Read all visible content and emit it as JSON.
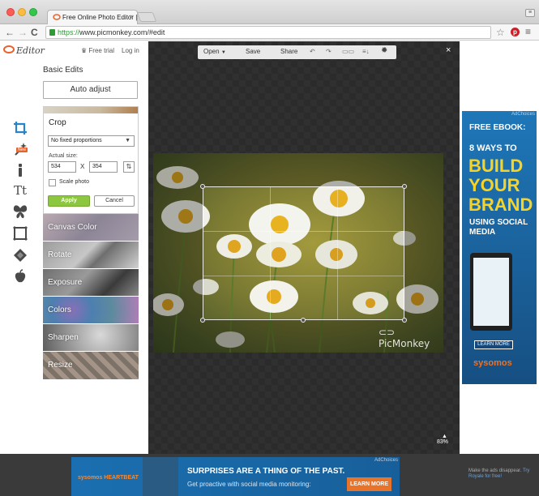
{
  "browser": {
    "tab_title": "Free Online Photo Editor |",
    "tab_close": "×",
    "url_scheme": "https://",
    "url_rest": "www.picmonkey.com/#edit",
    "back": "←",
    "forward": "→",
    "reload": "C",
    "star": "☆",
    "pinterest": "p",
    "menu": "≡"
  },
  "header": {
    "logo": "Editor",
    "free_trial": "Free trial",
    "login": "Log in"
  },
  "basic_edits": {
    "title": "Basic Edits",
    "auto_adjust": "Auto adjust"
  },
  "crop": {
    "title": "Crop",
    "proportions": "No fixed proportions",
    "actual_size_label": "Actual size:",
    "width": "534",
    "x_sep": "X",
    "height": "354",
    "scale_label": "Scale photo",
    "apply": "Apply",
    "cancel": "Cancel"
  },
  "edit_list": [
    "Canvas Color",
    "Rotate",
    "Exposure",
    "Colors",
    "Sharpen",
    "Resize"
  ],
  "tools": {
    "new_badge": "New",
    "text_tool": "Tt"
  },
  "editor_toolbar": {
    "open": "Open",
    "save": "Save",
    "share": "Share",
    "close": "×",
    "zoom": "83%"
  },
  "photo": {
    "watermark": "PicMonkey"
  },
  "right_ad": {
    "adchoices": "AdChoices",
    "line1": "FREE EBOOK:",
    "line2": "8 WAYS TO",
    "line3": "BUILD YOUR BRAND",
    "line4": "USING SOCIAL MEDIA",
    "learn_more": "LEARN MORE",
    "brand": "sysomos"
  },
  "bottom_ad": {
    "adchoices": "AdChoices",
    "brand": "sysomos HEARTBEAT",
    "headline": "SURPRISES ARE A THING OF THE PAST.",
    "subline": "Get proactive with social media monitoring:",
    "learn_more": "LEARN MORE"
  },
  "ads_note": {
    "text": "Make the ads disappear.",
    "link": "Try Royale for free!"
  },
  "colors": {
    "accent_blue": "#2a83c7",
    "apply_green": "#8dc63f",
    "brand_orange": "#e8632a"
  }
}
